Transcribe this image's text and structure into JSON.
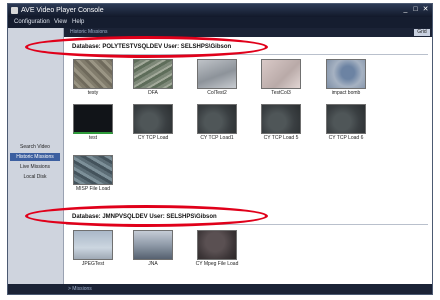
{
  "window": {
    "title": "AVE Video Player Console",
    "controls": [
      "_",
      "□",
      "✕"
    ]
  },
  "menu": [
    "Configuration",
    "View",
    "Help"
  ],
  "sidebar": {
    "items": [
      {
        "label": "Search Video",
        "active": false
      },
      {
        "label": "Historic Missions",
        "active": true
      },
      {
        "label": "Live Missions",
        "active": false
      },
      {
        "label": "Local Disk",
        "active": false
      }
    ]
  },
  "panel": {
    "header": "Historic Missions",
    "grid_button": "Grid"
  },
  "databases": [
    {
      "label": "Database: POLYTESTVSQLDEV  User: SELSHPS\\Gibson",
      "items": [
        {
          "label": "testy",
          "icon": "img-aerial"
        },
        {
          "label": "DFA",
          "icon": "img-aerial2"
        },
        {
          "label": "ColTest2",
          "icon": "img-road"
        },
        {
          "label": "TestCol3",
          "icon": "img-pale"
        },
        {
          "label": "impact bomb",
          "icon": "img-blue"
        },
        {
          "label": "test",
          "icon": "img-dark"
        },
        {
          "label": "CY TCP Load",
          "icon": "img-tcp"
        },
        {
          "label": "CY TCP Load1",
          "icon": "img-tcp"
        },
        {
          "label": "CY TCP Load 5",
          "icon": "img-tcp"
        },
        {
          "label": "CY TCP Load 6",
          "icon": "img-tcp"
        },
        {
          "label": "MISP File Load",
          "icon": "img-mosaic"
        }
      ]
    },
    {
      "label": "Database: JMNPVSQLDEV  User: SELSHPS\\Gibson",
      "items": [
        {
          "label": "JPEGTest",
          "icon": "img-sky"
        },
        {
          "label": "JNA",
          "icon": "img-field"
        },
        {
          "label": "CY Mpeg File Load",
          "icon": "img-mpeg"
        }
      ]
    }
  ],
  "footer": "> Missions",
  "annotation_color": "#e0001a"
}
